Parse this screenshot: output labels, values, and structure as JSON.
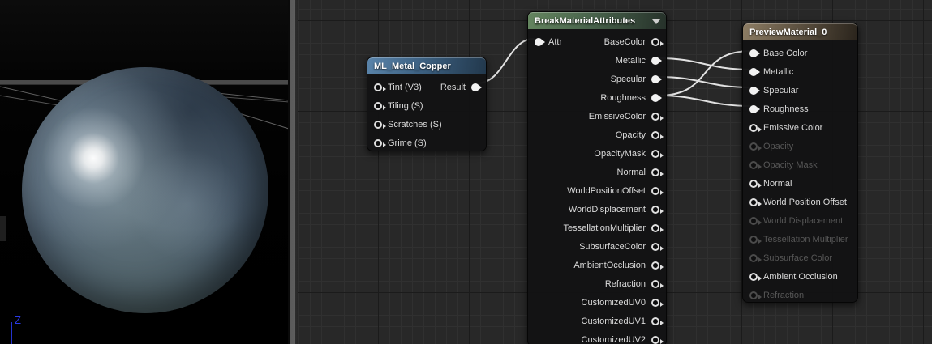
{
  "viewport": {
    "axis_label": "Z",
    "axis_color": "#2a3ae8"
  },
  "colors": {
    "ml_header": "#4a7096",
    "break_header": "#55754f",
    "preview_header": "#8d7d64",
    "wire": "#e2e2e2",
    "graph_background": "#282828"
  },
  "nodes": {
    "ml": {
      "title": "ML_Metal_Copper",
      "inputs": [
        {
          "label": "Tint (V3)",
          "state": "hollow"
        },
        {
          "label": "Tiling (S)",
          "state": "hollow"
        },
        {
          "label": "Scratches (S)",
          "state": "hollow"
        },
        {
          "label": "Grime (S)",
          "state": "hollow"
        }
      ],
      "output": {
        "label": "Result",
        "state": "filled"
      }
    },
    "break": {
      "title": "BreakMaterialAttributes",
      "input": {
        "label": "Attr",
        "state": "filled"
      },
      "outputs": [
        {
          "label": "BaseColor",
          "state": "hollow"
        },
        {
          "label": "Metallic",
          "state": "filled"
        },
        {
          "label": "Specular",
          "state": "filled"
        },
        {
          "label": "Roughness",
          "state": "filled"
        },
        {
          "label": "EmissiveColor",
          "state": "hollow"
        },
        {
          "label": "Opacity",
          "state": "hollow"
        },
        {
          "label": "OpacityMask",
          "state": "hollow"
        },
        {
          "label": "Normal",
          "state": "hollow"
        },
        {
          "label": "WorldPositionOffset",
          "state": "hollow"
        },
        {
          "label": "WorldDisplacement",
          "state": "hollow"
        },
        {
          "label": "TessellationMultiplier",
          "state": "hollow"
        },
        {
          "label": "SubsurfaceColor",
          "state": "hollow"
        },
        {
          "label": "AmbientOcclusion",
          "state": "hollow"
        },
        {
          "label": "Refraction",
          "state": "hollow"
        },
        {
          "label": "CustomizedUV0",
          "state": "hollow"
        },
        {
          "label": "CustomizedUV1",
          "state": "hollow"
        },
        {
          "label": "CustomizedUV2",
          "state": "hollow"
        }
      ]
    },
    "preview": {
      "title": "PreviewMaterial_0",
      "inputs": [
        {
          "label": "Base Color",
          "state": "filled"
        },
        {
          "label": "Metallic",
          "state": "filled"
        },
        {
          "label": "Specular",
          "state": "filled"
        },
        {
          "label": "Roughness",
          "state": "filled"
        },
        {
          "label": "Emissive Color",
          "state": "hollow"
        },
        {
          "label": "Opacity",
          "state": "disabled"
        },
        {
          "label": "Opacity Mask",
          "state": "disabled"
        },
        {
          "label": "Normal",
          "state": "hollow"
        },
        {
          "label": "World Position Offset",
          "state": "hollow"
        },
        {
          "label": "World Displacement",
          "state": "disabled"
        },
        {
          "label": "Tessellation Multiplier",
          "state": "disabled"
        },
        {
          "label": "Subsurface Color",
          "state": "disabled"
        },
        {
          "label": "Ambient Occlusion",
          "state": "hollow"
        },
        {
          "label": "Refraction",
          "state": "disabled"
        }
      ]
    }
  },
  "connections": [
    {
      "from": "ML_Metal_Copper.Result",
      "to": "BreakMaterialAttributes.Attr"
    },
    {
      "from": "BreakMaterialAttributes.Metallic",
      "to": "PreviewMaterial_0.Metallic"
    },
    {
      "from": "BreakMaterialAttributes.Specular",
      "to": "PreviewMaterial_0.Specular"
    },
    {
      "from": "BreakMaterialAttributes.Roughness",
      "to": "PreviewMaterial_0.Base Color"
    },
    {
      "from": "BreakMaterialAttributes.Roughness",
      "to": "PreviewMaterial_0.Roughness"
    }
  ]
}
